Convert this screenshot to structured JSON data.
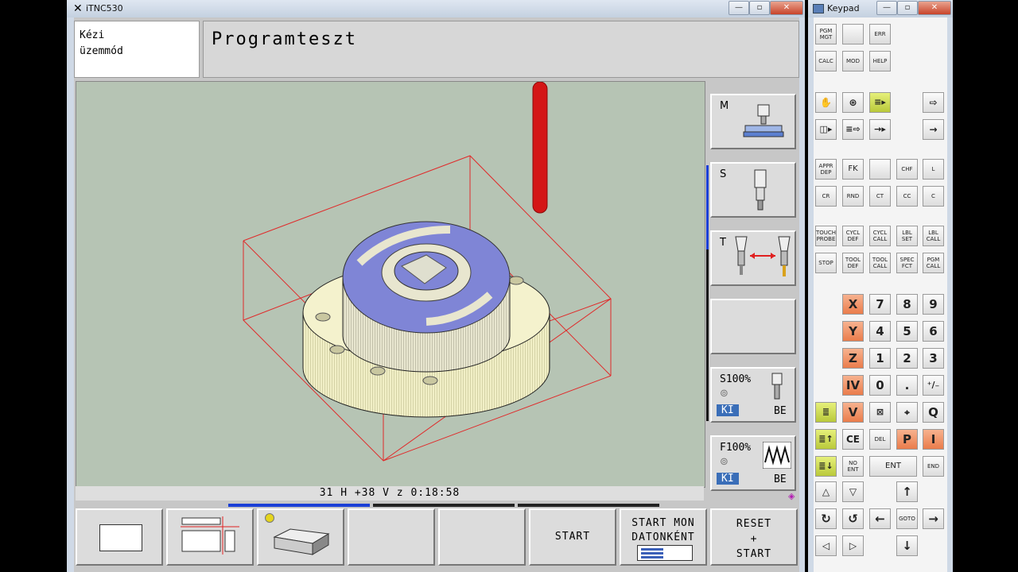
{
  "tnc_window": {
    "title": "iTNC530",
    "min": "—",
    "max": "▫",
    "close": "✕"
  },
  "mode": {
    "line1": "Kézi",
    "line2": "üzemmód"
  },
  "program_title": "Programteszt",
  "status": {
    "text": "31 H +38 V z    0:18:58"
  },
  "side_keys": [
    {
      "label": "M"
    },
    {
      "label": "S"
    },
    {
      "label": "T"
    },
    {
      "label": ""
    }
  ],
  "override_s": {
    "label": "S100%",
    "off": "KI",
    "on": "BE"
  },
  "override_f": {
    "label": "F100%",
    "off": "KI",
    "on": "BE"
  },
  "soft_keys": {
    "start": "START",
    "single_line1": "START MON",
    "single_line2": "DATONKÉNT",
    "reset_line1": "RESET",
    "reset_line2": "+",
    "reset_line3": "START"
  },
  "keypad": {
    "title": "Keypad",
    "rows": [
      [
        "PGM MGT",
        "",
        "ERR"
      ],
      [
        "CALC",
        "MOD",
        "HELP"
      ]
    ],
    "mode_keys": [
      "✋",
      "⊛",
      "≡▸",
      "⇨",
      "◫▸",
      "≡⇨",
      "→▸",
      "→"
    ],
    "path_keys": [
      "APPR DEP",
      "FK",
      "",
      "CHF",
      "L",
      "CR",
      "RND",
      "CT",
      "CC",
      "C"
    ],
    "cycle_keys": [
      "TOUCH PROBE",
      "CYCL DEF",
      "CYCL CALL",
      "LBL SET",
      "LBL CALL",
      "STOP",
      "TOOL DEF",
      "TOOL CALL",
      "SPEC FCT",
      "PGM CALL"
    ],
    "axis_keys": [
      "X",
      "Y",
      "Z",
      "IV",
      "V"
    ],
    "digits": [
      [
        "7",
        "8",
        "9"
      ],
      [
        "4",
        "5",
        "6"
      ],
      [
        "1",
        "2",
        "3"
      ],
      [
        "0",
        ".",
        "⁺∕₋"
      ]
    ],
    "misc": [
      "⊠",
      "⌖",
      "Q",
      "CE",
      "DEL",
      "P",
      "I",
      "NO ENT",
      "ENT",
      "END"
    ],
    "nav": [
      "△",
      "▽",
      "↑",
      "↻",
      "↺",
      "←",
      "GOTO",
      "→",
      "◁",
      "▷",
      "↓"
    ]
  },
  "colors": {
    "viewport": "#b6c4b4",
    "part_base": "#f0eec0",
    "part_top": "#7f85d6",
    "blank": "#e02a2a",
    "tool": "#d41616"
  }
}
